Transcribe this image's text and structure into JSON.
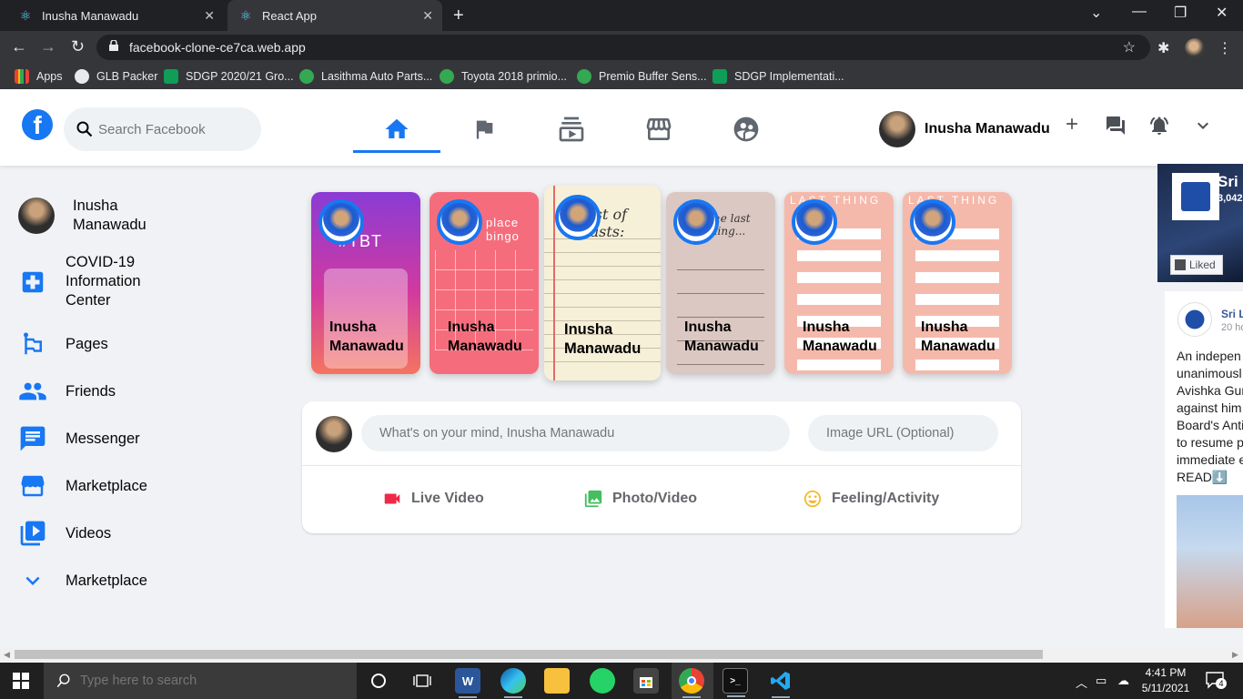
{
  "browser": {
    "tabs": [
      {
        "label": "Inusha Manawadu",
        "icon": "react-icon",
        "active": false
      },
      {
        "label": "React App",
        "icon": "react-icon",
        "active": true
      }
    ],
    "url": "facebook-clone-ce7ca.web.app",
    "bookmarks": [
      {
        "label": "Apps",
        "icon": "apps-grid-icon"
      },
      {
        "label": "GLB Packer",
        "icon": "globe-icon"
      },
      {
        "label": "SDGP 2020/21 Gro...",
        "icon": "sheets-icon"
      },
      {
        "label": "Lasithma Auto Parts...",
        "icon": "whatsapp-icon"
      },
      {
        "label": "Toyota 2018 primio...",
        "icon": "whatsapp-icon"
      },
      {
        "label": "Premio Buffer Sens...",
        "icon": "whatsapp-icon"
      },
      {
        "label": "SDGP Implementati...",
        "icon": "sheets-icon"
      }
    ]
  },
  "header": {
    "search_placeholder": "Search Facebook",
    "nav": [
      {
        "name": "home",
        "icon": "home-icon",
        "active": true
      },
      {
        "name": "pages",
        "icon": "flag-icon",
        "active": false
      },
      {
        "name": "watch",
        "icon": "subscriptions-icon",
        "active": false
      },
      {
        "name": "marketplace",
        "icon": "storefront-icon",
        "active": false
      },
      {
        "name": "groups",
        "icon": "supervised-user-icon",
        "active": false
      }
    ],
    "user_name": "Inusha Manawadu",
    "right_icons": [
      "add-icon",
      "forum-icon",
      "notifications-icon",
      "expand-more-icon"
    ]
  },
  "sidebar": {
    "items": [
      {
        "label": "Inusha Manawadu",
        "icon": "avatar"
      },
      {
        "label": "COVID-19 Information Center",
        "icon": "local-hospital-icon"
      },
      {
        "label": "Pages",
        "icon": "emoji-flags-icon"
      },
      {
        "label": "Friends",
        "icon": "people-icon"
      },
      {
        "label": "Messenger",
        "icon": "chat-icon"
      },
      {
        "label": "Marketplace",
        "icon": "storefront-icon"
      },
      {
        "label": "Videos",
        "icon": "video-library-icon"
      },
      {
        "label": "Marketplace",
        "icon": "expand-more-icon"
      }
    ]
  },
  "stories": [
    {
      "name": "Inusha Manawadu",
      "theme": "tbt",
      "heading": "#TBT"
    },
    {
      "name": "Inusha Manawadu",
      "theme": "bingo",
      "heading": "place bingo"
    },
    {
      "name": "Inusha Manawadu",
      "theme": "list-of-lasts",
      "heading": "List of Lasts:"
    },
    {
      "name": "Inusha Manawadu",
      "theme": "the-last-thing",
      "heading": "The last thing..."
    },
    {
      "name": "Inusha Manawadu",
      "theme": "last-thing",
      "heading": "LAST THING"
    },
    {
      "name": "Inusha Manawadu",
      "theme": "last-thing",
      "heading": "LAST THING"
    }
  ],
  "composer": {
    "message_placeholder": "What's on your mind, Inusha Manawadu",
    "image_placeholder": "Image URL (Optional)",
    "options": [
      {
        "label": "Live Video",
        "icon": "videocam-icon",
        "color": "#f02849"
      },
      {
        "label": "Photo/Video",
        "icon": "photo-library-icon",
        "color": "#45bd62"
      },
      {
        "label": "Feeling/Activity",
        "icon": "insert-emoticon-icon",
        "color": "#f7b928"
      }
    ]
  },
  "right_widget": {
    "page_name": "Sri",
    "page_count": "3,042",
    "liked_label": "Liked",
    "post_author": "Sri L",
    "post_time": "20 ho",
    "post_text": "An indepen\nunanimousl\nAvishka Gun\nagainst him\nBoard's Anti\nto resume p\nimmediate e\nREAD⬇️"
  },
  "taskbar": {
    "search_placeholder": "Type here to search",
    "apps": [
      "cortana-icon",
      "task-view-icon",
      "word-icon",
      "edge-icon",
      "file-explorer-icon",
      "whatsapp-icon",
      "store-icon",
      "chrome-icon",
      "terminal-icon",
      "vscode-icon"
    ],
    "time": "4:41 PM",
    "date": "5/11/2021",
    "notifications": "4"
  },
  "colors": {
    "fb_blue": "#1877f2",
    "page_bg": "#f0f2f5",
    "live_red": "#f02849",
    "photo_green": "#45bd62",
    "feeling_yellow": "#f7b928"
  }
}
